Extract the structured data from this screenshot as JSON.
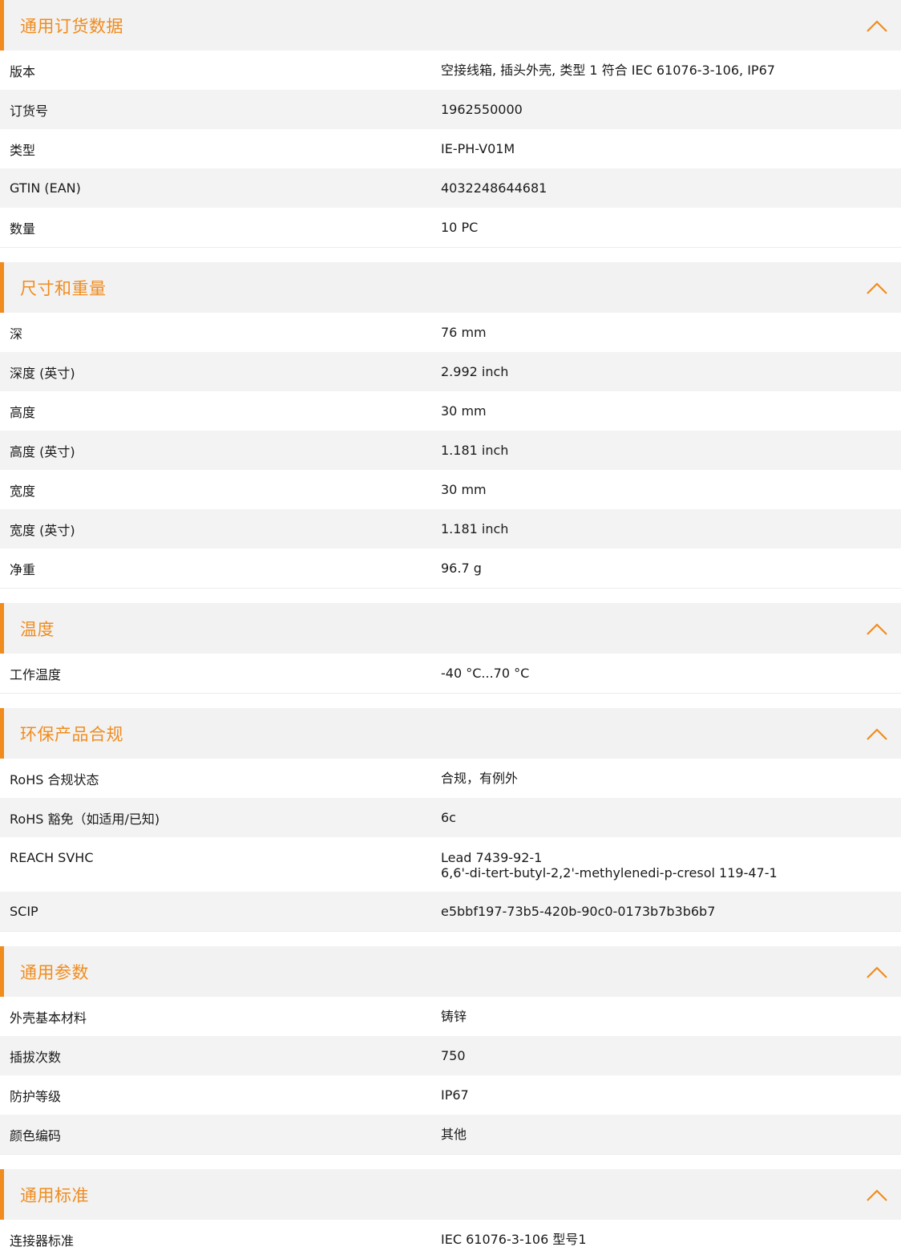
{
  "colors": {
    "accent": "#f08c1e",
    "row_alt": "#f3f3f3",
    "header_bg": "#f2f2f2"
  },
  "icons": {
    "collapse": "chevron-up-icon"
  },
  "sections": [
    {
      "title": "通用订货数据",
      "rows": [
        {
          "label": "版本",
          "value": "空接线箱, 插头外壳, 类型 1 符合 IEC 61076-3-106, IP67"
        },
        {
          "label": "订货号",
          "value": "1962550000"
        },
        {
          "label": "类型",
          "value": "IE-PH-V01M"
        },
        {
          "label": "GTIN (EAN)",
          "value": "4032248644681"
        },
        {
          "label": "数量",
          "value": "10  PC"
        }
      ]
    },
    {
      "title": "尺寸和重量",
      "rows": [
        {
          "label": "深",
          "value": "76  mm"
        },
        {
          "label": "深度 (英寸)",
          "value": "2.992  inch"
        },
        {
          "label": "高度",
          "value": "30  mm"
        },
        {
          "label": "高度 (英寸)",
          "value": "1.181  inch"
        },
        {
          "label": "宽度",
          "value": "30  mm"
        },
        {
          "label": "宽度 (英寸)",
          "value": "1.181  inch"
        },
        {
          "label": "净重",
          "value": "96.7  g"
        }
      ]
    },
    {
      "title": "温度",
      "rows": [
        {
          "label": "工作温度",
          "value": "-40 °C...70 °C"
        }
      ]
    },
    {
      "title": "环保产品合规",
      "rows": [
        {
          "label": "RoHS 合规状态",
          "value": "合规，有例外"
        },
        {
          "label": "RoHS 豁免（如适用/已知)",
          "value": "6c"
        },
        {
          "label": "REACH SVHC",
          "value": "Lead 7439-92-1",
          "value2": "6,6'-di-tert-butyl-2,2'-methylenedi-p-cresol 119-47-1"
        },
        {
          "label": "SCIP",
          "value": "e5bbf197-73b5-420b-90c0-0173b7b3b6b7"
        }
      ]
    },
    {
      "title": "通用参数",
      "rows": [
        {
          "label": "外壳基本材料",
          "value": "铸锌"
        },
        {
          "label": "插拔次数",
          "value": "750"
        },
        {
          "label": "防护等级",
          "value": "IP67"
        },
        {
          "label": "颜色编码",
          "value": "其他"
        }
      ]
    },
    {
      "title": "通用标准",
      "rows": [
        {
          "label": "连接器标准",
          "value": "IEC 61076-3-106 型号1"
        }
      ]
    }
  ]
}
